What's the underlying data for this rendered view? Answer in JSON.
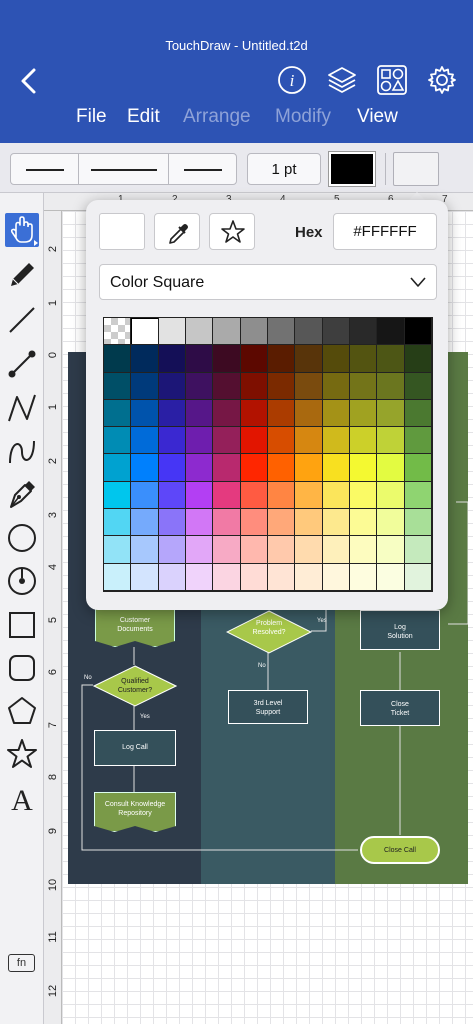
{
  "app": {
    "title": "TouchDraw - Untitled.t2d"
  },
  "header": {
    "menus": [
      {
        "label": "File",
        "enabled": true
      },
      {
        "label": "Edit",
        "enabled": true
      },
      {
        "label": "Arrange",
        "enabled": false
      },
      {
        "label": "Modify",
        "enabled": false
      },
      {
        "label": "View",
        "enabled": true
      }
    ],
    "icons": [
      "back-icon",
      "info-icon",
      "layers-icon",
      "shapes-library-icon",
      "settings-gear-icon"
    ]
  },
  "stylebar": {
    "line_width": "1 pt",
    "stroke_color": "#000000",
    "fill_color": "#F2F2F4"
  },
  "rulers": {
    "top": [
      "1",
      "2",
      "3",
      "4",
      "5",
      "6",
      "7"
    ],
    "left": [
      "2",
      "1",
      "0",
      "1",
      "2",
      "3",
      "4",
      "5",
      "6",
      "7",
      "8",
      "9",
      "10",
      "11",
      "12"
    ]
  },
  "sidebar": {
    "tools": [
      "pointer-tool-icon",
      "pencil-tool-icon",
      "line-tool-icon",
      "point-line-tool-icon",
      "polyline-tool-icon",
      "curve-tool-icon",
      "pen-tool-icon",
      "ellipse-tool-icon",
      "circle-center-tool-icon",
      "rectangle-tool-icon",
      "rounded-rect-tool-icon",
      "pentagon-tool-icon",
      "star-tool-icon",
      "text-tool-icon"
    ],
    "fn_label": "fn"
  },
  "diagram": {
    "lanes": [
      "#2e3b4a",
      "#3a5a63",
      "#5a7a44"
    ],
    "nodes": {
      "customer_documents": "Customer\nDocuments",
      "problem_resolved": "Problem\nResolved?",
      "log_solution": "Log\nSolution",
      "qualified_customer": "Qualified\nCustomer?",
      "third_level": "3rd Level\nSupport",
      "close_ticket": "Close\nTicket",
      "log_call": "Log Call",
      "consult_repo": "Consult Knowledge\nRepository",
      "close_call": "Close Call"
    },
    "labels": {
      "yes1": "Yes",
      "no1": "No",
      "yes2": "Yes",
      "no2": "No"
    }
  },
  "color_popover": {
    "current_color": "#FFFFFF",
    "hex_label": "Hex",
    "hex_value": "#FFFFFF",
    "palette_mode": "Color Square",
    "icons": [
      "eyedropper-icon",
      "star-favorite-icon",
      "chevron-down-icon"
    ],
    "palette": [
      [
        "#ffffff",
        "#ffffff",
        "#e2e2e2",
        "#c6c6c6",
        "#aaaaaa",
        "#8e8e8e",
        "#727272",
        "#575757",
        "#3e3e3e",
        "#292929",
        "#161616",
        "#000000"
      ],
      [
        "#003a4d",
        "#002a5c",
        "#140f57",
        "#2e0c47",
        "#3d0a22",
        "#5c0800",
        "#5a1c00",
        "#58340a",
        "#554b0b",
        "#535411",
        "#4d5615",
        "#263e17"
      ],
      [
        "#004f67",
        "#003a7b",
        "#1c1677",
        "#3e1160",
        "#540f30",
        "#7e0f00",
        "#7b2a00",
        "#7a4b0e",
        "#766a11",
        "#737419",
        "#6b761f",
        "#355622"
      ],
      [
        "#006f8f",
        "#0053ac",
        "#2a1fa5",
        "#561789",
        "#761745",
        "#b21200",
        "#ab3c00",
        "#a9690f",
        "#a49217",
        "#a0a221",
        "#96a42b",
        "#4b7930"
      ],
      [
        "#008cb4",
        "#006bd9",
        "#3a28d1",
        "#6e1eae",
        "#94205a",
        "#e21500",
        "#d74d00",
        "#d68711",
        "#d0ba1c",
        "#ccd029",
        "#bfd237",
        "#609a3e"
      ],
      [
        "#00a2d0",
        "#0080fd",
        "#4636f5",
        "#8d2acf",
        "#b8296e",
        "#ff2600",
        "#ff6100",
        "#ffa310",
        "#f8e020",
        "#f4f931",
        "#e3fb41",
        "#72bb48"
      ],
      [
        "#00c6ed",
        "#3a8ffc",
        "#5e47f9",
        "#b33ff3",
        "#e43a7f",
        "#ff5b42",
        "#ff8543",
        "#ffb545",
        "#fbe55b",
        "#fafa65",
        "#ebfb6c",
        "#8fd471"
      ],
      [
        "#52d6f3",
        "#75aafc",
        "#8a74f9",
        "#d277f6",
        "#f17aa5",
        "#ff8d7d",
        "#ffa879",
        "#ffc97c",
        "#fde98e",
        "#fcfb95",
        "#f1fd9b",
        "#a8df98"
      ],
      [
        "#92e3f7",
        "#a7c8fd",
        "#b5a6fb",
        "#e2a7f8",
        "#f7aac5",
        "#ffb8ae",
        "#ffc9ac",
        "#ffdbae",
        "#fef0bb",
        "#fdfcbf",
        "#f7fec3",
        "#c5eabd"
      ],
      [
        "#c9f0fb",
        "#d3e4fe",
        "#dad2fd",
        "#f0d3fb",
        "#fbd5e2",
        "#ffdcd6",
        "#ffe4d5",
        "#ffedd6",
        "#fff7dd",
        "#fefddf",
        "#fbfee1",
        "#e1f3dd"
      ]
    ],
    "selected_cell": [
      0,
      1
    ]
  }
}
